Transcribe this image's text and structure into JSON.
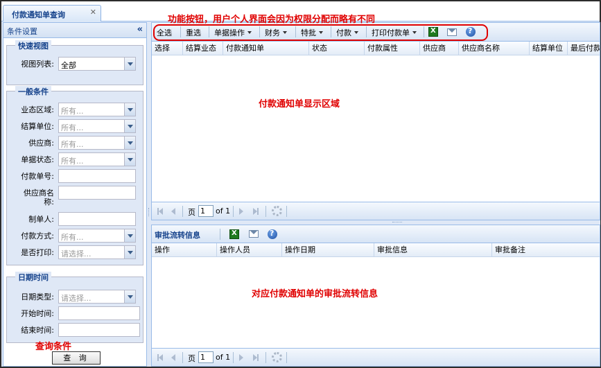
{
  "tab": {
    "label": "付款通知单查询",
    "close": "✕"
  },
  "left": {
    "header": "条件设置",
    "collapse": "«",
    "quick_view": {
      "legend": "快速视图",
      "view_list_label": "视图列表:",
      "view_list_value": "全部"
    },
    "general": {
      "legend": "一般条件",
      "fields": [
        {
          "label": "业态区域:",
          "type": "combo",
          "value": "所有..."
        },
        {
          "label": "结算单位:",
          "type": "combo",
          "value": "所有..."
        },
        {
          "label": "供应商:",
          "type": "combo",
          "value": "所有..."
        },
        {
          "label": "单据状态:",
          "type": "combo",
          "value": "所有..."
        },
        {
          "label": "付款单号:",
          "type": "text",
          "value": ""
        },
        {
          "label": "供应商名",
          "label2": "称:",
          "type": "text",
          "value": ""
        },
        {
          "label": "制单人:",
          "type": "text",
          "value": ""
        },
        {
          "label": "付款方式:",
          "type": "combo",
          "value": "所有..."
        },
        {
          "label": "是否打印:",
          "type": "combo",
          "value": "请选择..."
        }
      ]
    },
    "datetime": {
      "legend": "日期时间",
      "date_type_label": "日期类型:",
      "date_type_value": "请选择...",
      "start_label": "开始时间:",
      "end_label": "结束时间:"
    },
    "query_note": "查询条件",
    "query_button": "查 询"
  },
  "toolbar": {
    "select_all": "全选",
    "reselect": "重选",
    "doc_ops": "单据操作",
    "finance": "财务",
    "special": "特批",
    "payment": "付款",
    "print": "打印付款单",
    "excel_icon": "excel-export-icon",
    "mail_icon": "mail-icon",
    "help_icon": "help-icon"
  },
  "func_note": "功能按钮，用户个人界面会因为权限分配而略有不同",
  "main_grid": {
    "columns": [
      "选择",
      "结算业态",
      "付款通知单",
      "状态",
      "付款属性",
      "供应商",
      "供应商名称",
      "结算单位",
      "最后付款"
    ],
    "area_note": "付款通知单显示区域"
  },
  "pager": {
    "page_label": "页",
    "page_value": "1",
    "of_label": "of 1"
  },
  "approval": {
    "title": "审批流转信息",
    "columns": [
      "操作",
      "操作人员",
      "操作日期",
      "审批信息",
      "审批备注"
    ],
    "area_note": "对应付款通知单的审批流转信息"
  },
  "colors": {
    "annotation": "#e00000",
    "header_text": "#15428b",
    "border": "#99bbe8"
  }
}
